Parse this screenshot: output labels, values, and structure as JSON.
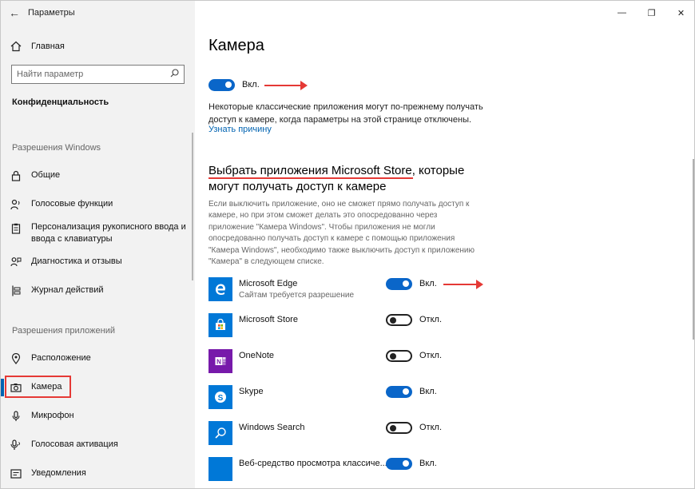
{
  "window": {
    "title": "Параметры"
  },
  "titlebar": {
    "back": "←",
    "minimize": "—",
    "restore": "❐",
    "close": "✕"
  },
  "sidebar": {
    "home": "Главная",
    "search_placeholder": "Найти параметр",
    "section": "Конфиденциальность",
    "groups": [
      {
        "title": "Разрешения Windows",
        "items": [
          {
            "label": "Общие",
            "icon": "lock-icon"
          },
          {
            "label": "Голосовые функции",
            "icon": "person-voice-icon"
          },
          {
            "label": "Персонализация рукописного ввода и\nввода с клавиатуры",
            "icon": "clipboard-icon"
          },
          {
            "label": "Диагностика и отзывы",
            "icon": "feedback-icon"
          },
          {
            "label": "Журнал действий",
            "icon": "timeline-icon"
          }
        ]
      },
      {
        "title": "Разрешения приложений",
        "items": [
          {
            "label": "Расположение",
            "icon": "location-icon"
          },
          {
            "label": "Камера",
            "icon": "camera-icon",
            "active": true
          },
          {
            "label": "Микрофон",
            "icon": "microphone-icon"
          },
          {
            "label": "Голосовая активация",
            "icon": "voice-activation-icon"
          },
          {
            "label": "Уведомления",
            "icon": "notifications-icon"
          }
        ]
      }
    ]
  },
  "main": {
    "title": "Камера",
    "master_toggle": {
      "state": "on",
      "label": "Вкл."
    },
    "notice": "Некоторые классические приложения могут по-прежнему получать доступ к камере, когда параметры на этой странице отключены.",
    "learn_more": "Узнать причину",
    "store_heading": "Выбрать приложения Microsoft Store, которые могут получать доступ к камере",
    "store_desc": "Если выключить приложение, оно не сможет прямо получать доступ к камере, но при этом сможет делать это опосредованно через приложение \"Камера Windows\". Чтобы приложения не могли опосредованно получать доступ к камере с помощью приложения \"Камера Windows\", необходимо также выключить доступ к приложению \"Камера\" в следующем списке.",
    "apps": [
      {
        "name": "Microsoft Edge",
        "subtitle": "Сайтам требуется разрешение",
        "state": "on",
        "label": "Вкл.",
        "color": "#0078d7",
        "icon": "edge-icon"
      },
      {
        "name": "Microsoft Store",
        "subtitle": "",
        "state": "off",
        "label": "Откл.",
        "color": "#0078d7",
        "icon": "store-icon"
      },
      {
        "name": "OneNote",
        "subtitle": "",
        "state": "off",
        "label": "Откл.",
        "color": "#7719aa",
        "icon": "onenote-icon"
      },
      {
        "name": "Skype",
        "subtitle": "",
        "state": "on",
        "label": "Вкл.",
        "color": "#0078d7",
        "icon": "skype-icon"
      },
      {
        "name": "Windows Search",
        "subtitle": "",
        "state": "off",
        "label": "Откл.",
        "color": "#0078d7",
        "icon": "search-icon"
      },
      {
        "name": "Веб-средство просмотра классиче...",
        "subtitle": "",
        "state": "on",
        "label": "Вкл.",
        "color": "#0078d7",
        "icon": "web-viewer-icon"
      }
    ]
  },
  "colors": {
    "accent": "#0063b1",
    "toggle_on": "#0a66c9",
    "annotation_red": "#e53935"
  }
}
